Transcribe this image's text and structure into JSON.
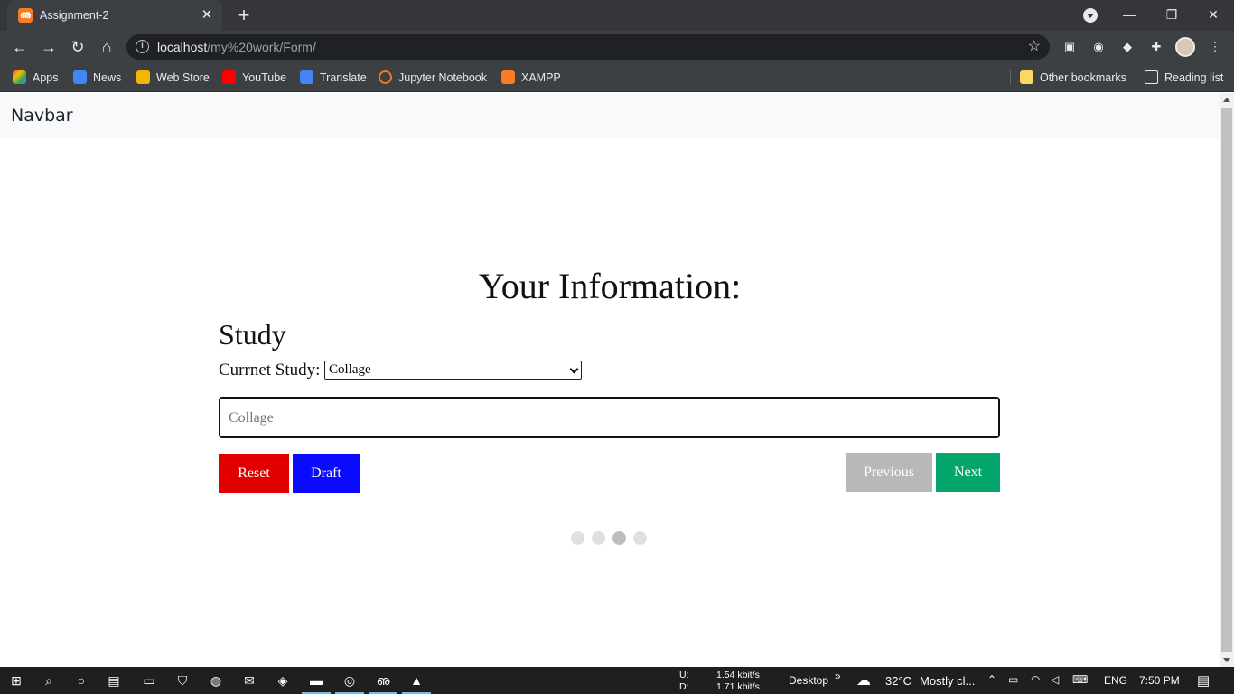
{
  "browser": {
    "tab_title": "Assignment-2",
    "tab_close": "✕",
    "new_tab": "+",
    "url_host": "localhost",
    "url_path": "/my%20work/Form/",
    "window": {
      "minimize": "—",
      "restore": "❐",
      "close": "✕"
    }
  },
  "bookmarks": {
    "items": [
      {
        "label": "Apps",
        "color": "#ea4335"
      },
      {
        "label": "News",
        "color": "#4285f4"
      },
      {
        "label": "Web Store",
        "color": "#f4b400"
      },
      {
        "label": "YouTube",
        "color": "#ff0000"
      },
      {
        "label": "Translate",
        "color": "#4285f4"
      },
      {
        "label": "Jupyter Notebook",
        "color": "#f37726"
      },
      {
        "label": "XAMPP",
        "color": "#fb7a24"
      }
    ],
    "other": "Other bookmarks",
    "reading_list": "Reading list"
  },
  "page": {
    "brand": "Navbar",
    "heading": "Your Information:",
    "section": "Study",
    "study_label": "Currnet Study:",
    "study_select_value": "Collage",
    "text_placeholder": "Collage",
    "buttons": {
      "reset": "Reset",
      "draft": "Draft",
      "previous": "Previous",
      "next": "Next"
    },
    "steps_total": 4,
    "steps_active": 3
  },
  "taskbar": {
    "net_up_label": "U:",
    "net_down_label": "D:",
    "net_up": "1.54 kbit/s",
    "net_down": "1.71 kbit/s",
    "desktop": "Desktop",
    "weather_temp": "32°C",
    "weather_text": "Mostly cl...",
    "language": "ENG",
    "time": "7:50 PM"
  },
  "colors": {
    "reset": "#e00000",
    "draft": "#0a0aff",
    "previous": "#b8b8b8",
    "next": "#05a66b"
  }
}
